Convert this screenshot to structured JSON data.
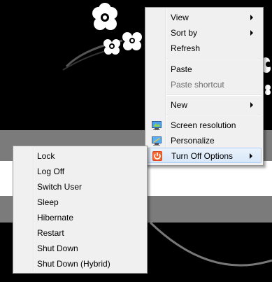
{
  "colors": {
    "menu_background": "#f0f0f0",
    "menu_border": "#979797",
    "highlight_border": "#aecff7",
    "highlight_fill": "#d8e7f8",
    "disabled_text": "#6d6d6d",
    "desktop_black": "#000000",
    "desktop_gray": "#7b7b7b",
    "desktop_white": "#ffffff"
  },
  "context_menu": {
    "items": [
      {
        "label": "View",
        "has_submenu": true,
        "icon": null,
        "enabled": true
      },
      {
        "label": "Sort by",
        "has_submenu": true,
        "icon": null,
        "enabled": true
      },
      {
        "label": "Refresh",
        "has_submenu": false,
        "icon": null,
        "enabled": true
      },
      {
        "label": "Paste",
        "has_submenu": false,
        "icon": null,
        "enabled": true
      },
      {
        "label": "Paste shortcut",
        "has_submenu": false,
        "icon": null,
        "enabled": false
      },
      {
        "label": "New",
        "has_submenu": true,
        "icon": null,
        "enabled": true
      },
      {
        "label": "Screen resolution",
        "has_submenu": false,
        "icon": "monitor-icon",
        "enabled": true
      },
      {
        "label": "Personalize",
        "has_submenu": false,
        "icon": "personalize-monitor-icon",
        "enabled": true
      },
      {
        "label": "Turn Off Options",
        "has_submenu": true,
        "icon": "power-icon",
        "enabled": true,
        "highlighted": true
      }
    ]
  },
  "turn_off_submenu": {
    "items": [
      {
        "label": "Lock"
      },
      {
        "label": "Log Off"
      },
      {
        "label": "Switch User"
      },
      {
        "label": "Sleep"
      },
      {
        "label": "Hibernate"
      },
      {
        "label": "Restart"
      },
      {
        "label": "Shut Down"
      },
      {
        "label": "Shut Down (Hybrid)"
      }
    ]
  }
}
